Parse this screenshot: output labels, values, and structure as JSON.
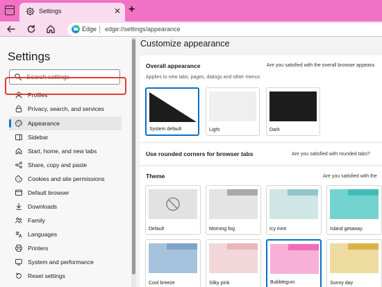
{
  "window": {
    "tab_title": "Settings",
    "close_glyph": "✕",
    "new_tab_glyph": "+"
  },
  "address_bar": {
    "site_label": "Edge",
    "url": "edge://settings/appearance"
  },
  "sidebar": {
    "title": "Settings",
    "search_placeholder": "Search settings",
    "items": [
      {
        "label": "Profiles",
        "icon": "profile-icon"
      },
      {
        "label": "Privacy, search, and services",
        "icon": "lock-icon"
      },
      {
        "label": "Appearance",
        "icon": "palette-icon",
        "active": true
      },
      {
        "label": "Sidebar",
        "icon": "sidebar-icon"
      },
      {
        "label": "Start, home, and new tabs",
        "icon": "home-icon"
      },
      {
        "label": "Share, copy and paste",
        "icon": "share-icon"
      },
      {
        "label": "Cookies and site permissions",
        "icon": "cookie-icon"
      },
      {
        "label": "Default browser",
        "icon": "browser-icon"
      },
      {
        "label": "Downloads",
        "icon": "download-icon"
      },
      {
        "label": "Family",
        "icon": "family-icon"
      },
      {
        "label": "Languages",
        "icon": "language-icon"
      },
      {
        "label": "Printers",
        "icon": "printer-icon"
      },
      {
        "label": "System and performance",
        "icon": "system-icon"
      },
      {
        "label": "Reset settings",
        "icon": "reset-icon"
      }
    ]
  },
  "main": {
    "title": "Customize appearance",
    "overall": {
      "title": "Overall appearance",
      "subtitle": "Applies to new tabs, pages, dialogs and other menus",
      "feedback": "Are you satisfied with the overall browser appeara",
      "options": [
        {
          "label": "System default",
          "selected": true
        },
        {
          "label": "Light",
          "selected": false
        },
        {
          "label": "Dark",
          "selected": false
        }
      ]
    },
    "rounded": {
      "title": "Use rounded corners for browser tabs",
      "feedback": "Are you satisfied with rounded tabs?"
    },
    "theme": {
      "title": "Theme",
      "feedback": "Are you satisfied with the",
      "items": [
        {
          "label": "Default",
          "color_top": "#d9d9d9",
          "color_body": "#e6e6e6",
          "selected": false
        },
        {
          "label": "Morning fog",
          "color_top": "#a9a9a9",
          "color_body": "#e4e4e4",
          "selected": false
        },
        {
          "label": "Icy mint",
          "color_top": "#8fc6c9",
          "color_body": "#cfe5e6",
          "selected": false
        },
        {
          "label": "Island getaway",
          "color_top": "#41bdb9",
          "color_body": "#72d3cf",
          "selected": false
        },
        {
          "label": "Cool breeze",
          "color_top": "#7fa4c8",
          "color_body": "#a7c2dd",
          "selected": false
        },
        {
          "label": "Silky pink",
          "color_top": "#e7b7bb",
          "color_body": "#f2d6d8",
          "selected": false
        },
        {
          "label": "Bubblegum",
          "color_top": "#f06cb9",
          "color_body": "#f7b0d7",
          "selected": true
        },
        {
          "label": "Sunny day",
          "color_top": "#d9b34a",
          "color_body": "#eedba0",
          "selected": false
        }
      ]
    }
  },
  "colors": {
    "titlebar": "#f272c5",
    "toolbar": "#fadcef",
    "accent": "#0a6fc6",
    "highlight": "#e53935"
  }
}
